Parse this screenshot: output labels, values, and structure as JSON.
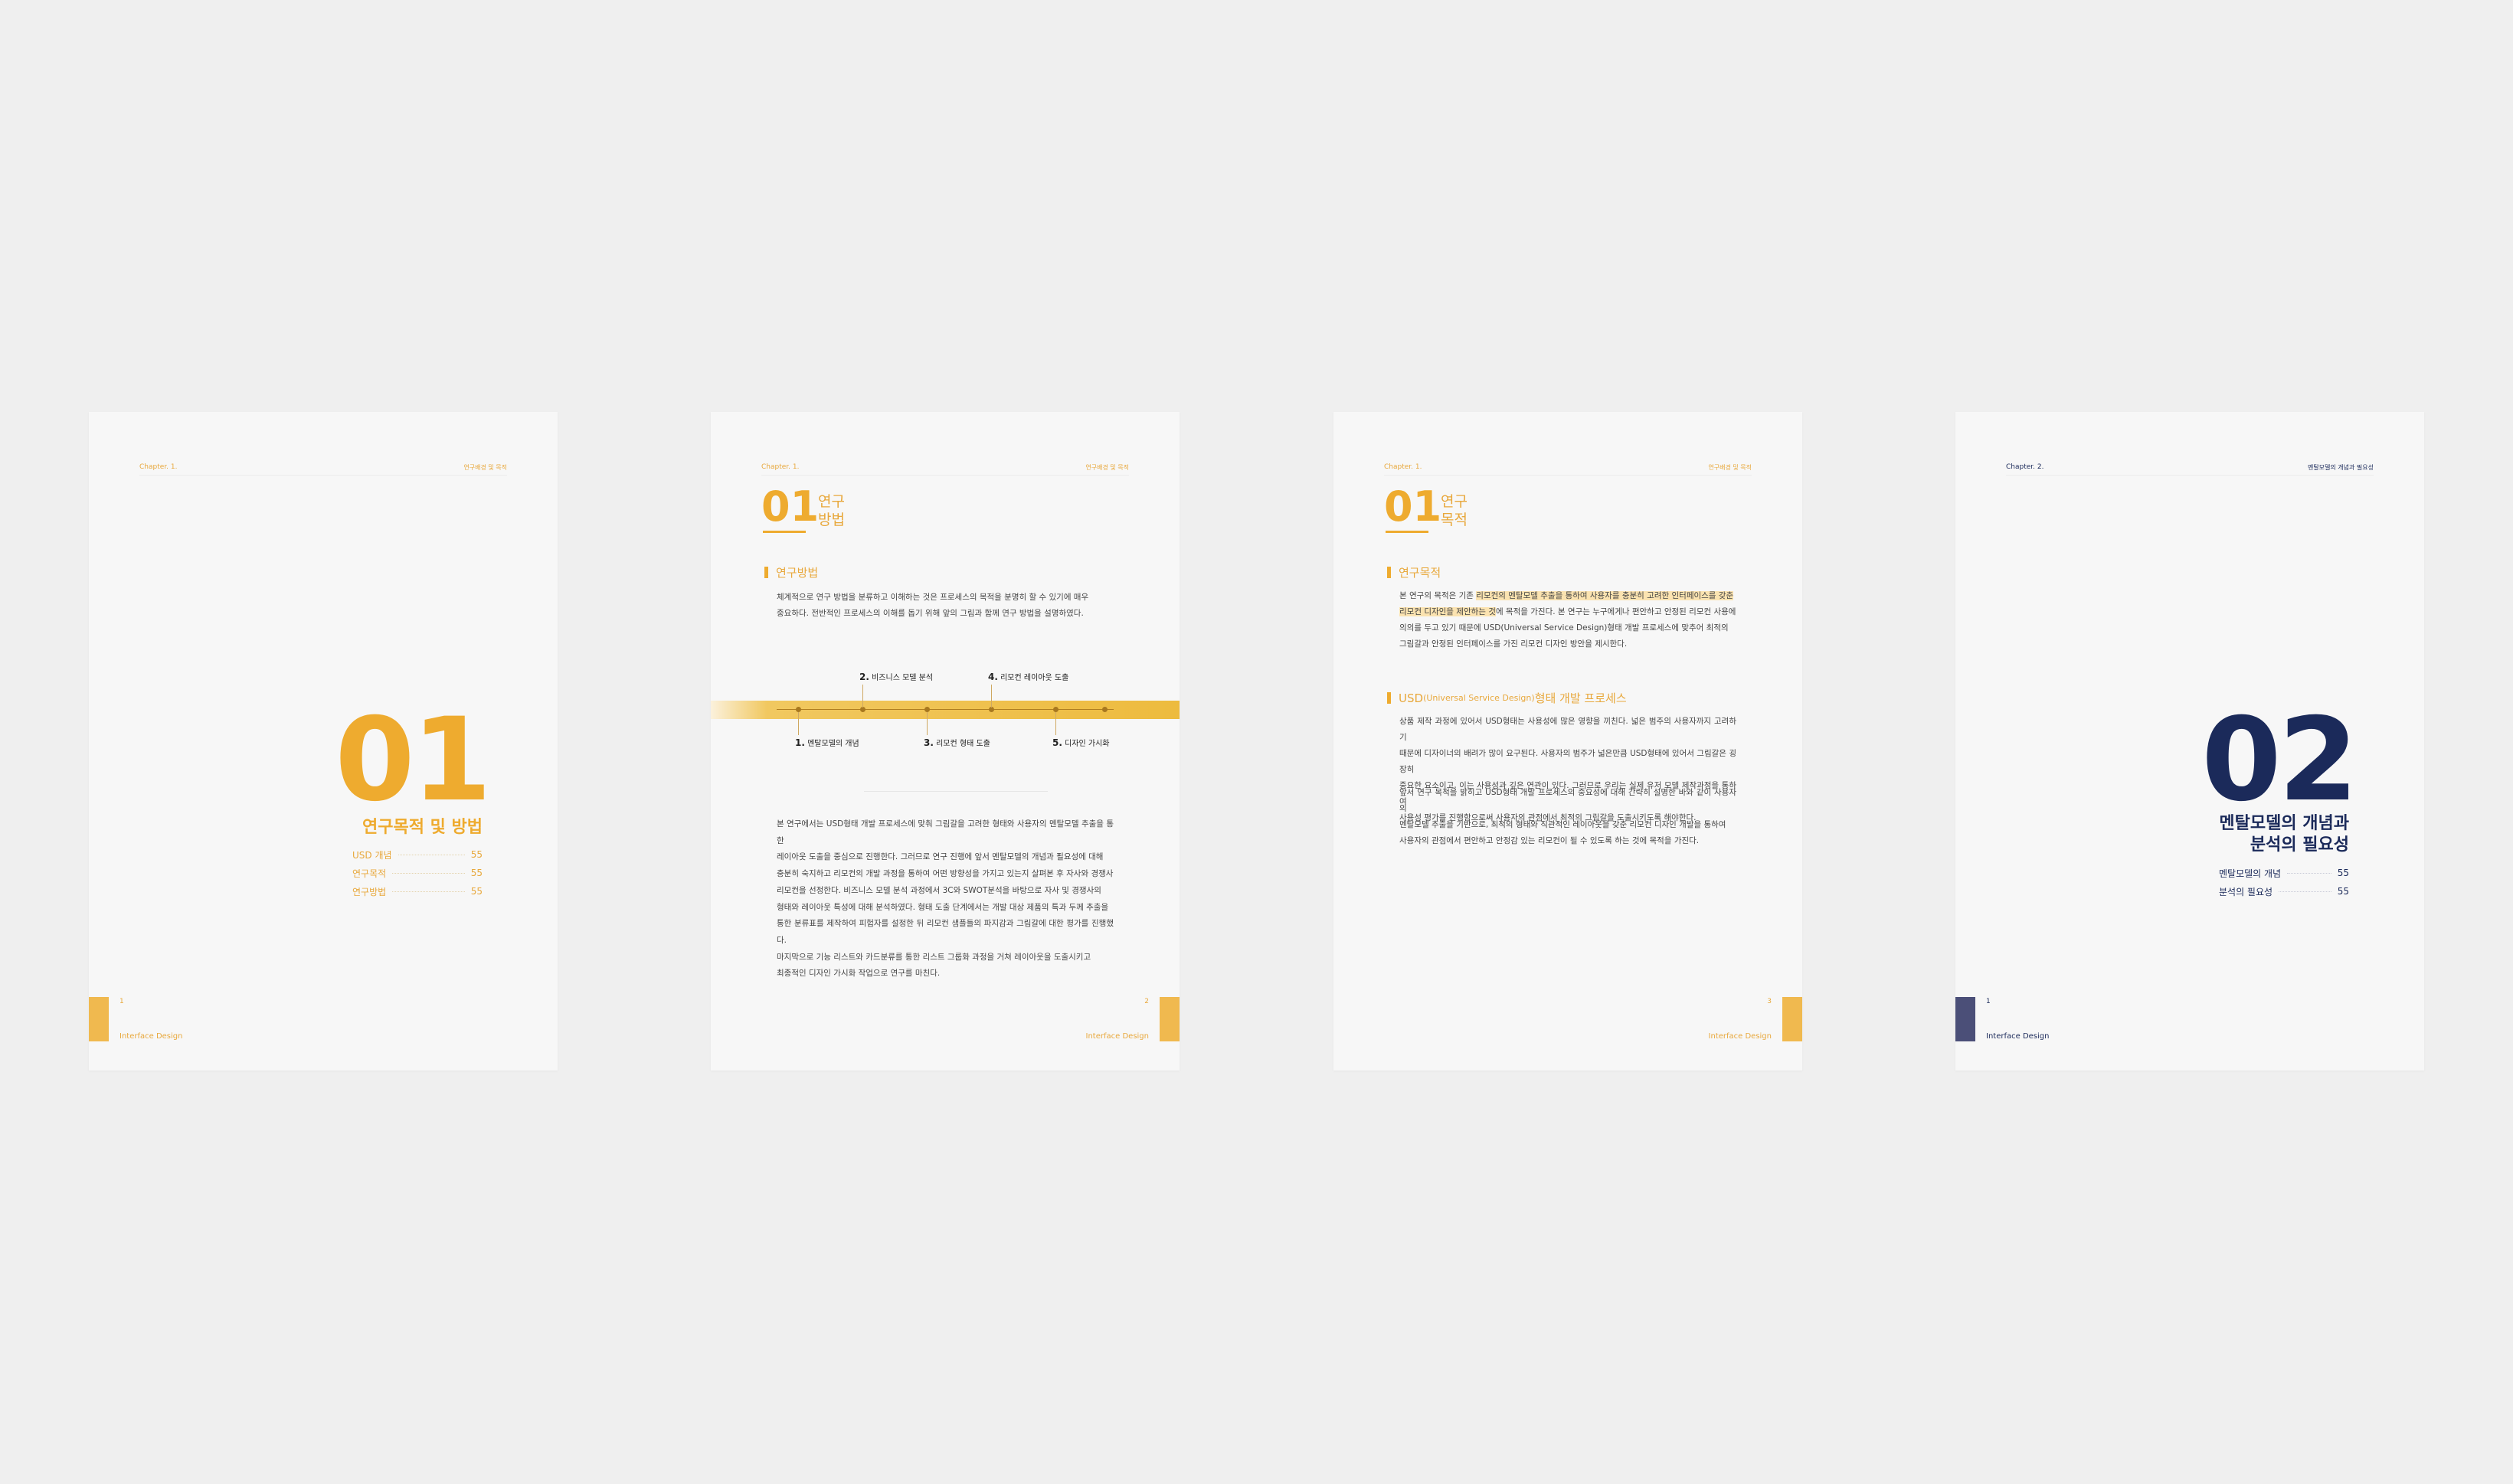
{
  "pages": [
    {
      "chapter": "Chapter. 1.",
      "header_right": "연구배경 및 목적",
      "big_number": "01",
      "title": "연구목적 및 방법",
      "toc": [
        {
          "label": "USD 개념",
          "page": "55"
        },
        {
          "label": "연구목적",
          "page": "55"
        },
        {
          "label": "연구방법",
          "page": "55"
        }
      ],
      "page_number": "1",
      "footer": "Interface Design"
    },
    {
      "chapter": "Chapter. 1.",
      "header_right": "연구배경 및 목적",
      "section_number": "01",
      "section_title": [
        "연구",
        "방법"
      ],
      "subheading": "연구방법",
      "intro_lines": [
        "체계적으로 연구 방법을 분류하고 이해하는 것은 프로세스의 목적을 분명히 할 수 있기에 매우",
        "중요하다. 전반적인 프로세스의 이해를 돕기 위해 앞의 그림과 함께 연구 방법을 설명하였다."
      ],
      "timeline": {
        "top": [
          {
            "num": "2.",
            "label": "비즈니스 모델 분석"
          },
          {
            "num": "4.",
            "label": "리모컨 레이아웃 도출"
          }
        ],
        "bottom": [
          {
            "num": "1.",
            "label": "멘탈모델의 개념"
          },
          {
            "num": "3.",
            "label": "리모컨 형태 도출"
          },
          {
            "num": "5.",
            "label": "디자인 가시화"
          }
        ]
      },
      "body_lines": [
        "본 연구에서는 USD형태 개발 프로세스에 맞춰 그림갈을 고려한 형태와 사용자의 멘탈모델 추출을 통한",
        "레이아웃 도출을 중심으로 진행한다. 그러므로 연구 진행에 앞서 멘탈모델의 개념과 필요성에 대해",
        "충분히 숙지하고 리모컨의 개발 과정을 통하여 어떤 방향성을 가지고 있는지 살펴본 후 자사와 경쟁사",
        "리모컨을 선정한다. 비즈니스 모델 분석 과정에서 3C와 SWOT분석을 바탕으로 자사 및 경쟁사의",
        "형태와 레이아웃 특성에 대해 분석하였다. 형태 도출 단계에서는 개발 대상 제품의 특과 두께 추출을",
        "통한 분류표를 제작하여 피험자를 설정한 뒤 리모컨 샘플들의 파지감과 그림갈에 대한 평가를 진행했다.",
        "마지막으로 기능 리스트와 카드분류를 통한 리스트 그룹화 과정을 거쳐 레이아웃을 도출시키고",
        "최종적인 디자인 가시화 작업으로 연구를 마친다."
      ],
      "page_number": "2",
      "footer": "Interface Design"
    },
    {
      "chapter": "Chapter. 1.",
      "header_right": "연구배경 및 목적",
      "section_number": "01",
      "section_title": [
        "연구",
        "목적"
      ],
      "subheading1": "연구목적",
      "para1": {
        "l1_pre": "본 연구의 목적은 기존 ",
        "l1_hl": "리모컨의 멘탈모델 추출을 통하여 사용자를 충분히 고려한 인터페이스를 갖춘",
        "l2_hl": "리모컨 디자인을 제안하는 것",
        "l2_post": "에 목적을 가진다. 본 연구는 누구에게나 편안하고 안정된 리모컨 사용에",
        "l3": "의의를 두고 있기 때문에 USD(Universal Service Design)형태 개발 프로세스에 맞추어 최적의",
        "l4": "그림갈과 안정된 인터페이스를 가진 리모컨 디자인 방안을 제시한다."
      },
      "subheading2_main": "USD",
      "subheading2_sub": "(Universal Service Design)",
      "subheading2_tail": "형태 개발 프로세스",
      "para2_lines": [
        "상품 제작 과정에 있어서 USD형태는 사용성에 많은 영향을 끼친다. 넓은 범주의 사용자까지 고려하기",
        "때문에 디자이너의 배려가 많이 요구된다. 사용자의 범주가 넓은만큼 USD형태에 있어서 그림갈은 굉장히",
        "중요한 요소이고, 이는 사용성과 깊은 연관이 있다. 그러므로 우리는 실제 유저 모델 제작과정을 통하여",
        "사용성 평가를 진행함으로써 사용자의 관점에서 최적의 그립갈을 도출시키도록 해야한다."
      ],
      "para3_lines": [
        "앞서 연구 목적을 밝히고 USD형태 개발 프로세스의 중요성에 대해 간략히 설명한 바와 같이 사용자의",
        "멘탈모델 추출을 기반으로, 최적의 형태와 직관적인 레이아웃을 갖춘 리모컨 디자인 개발을 통하여",
        "사용자의 관점에서 편안하고 안정감 있는 리모컨이 될 수 있도록 하는 것에 목적을 가진다."
      ],
      "page_number": "3",
      "footer": "Interface Design"
    },
    {
      "chapter": "Chapter. 2.",
      "header_right": "멘탈모델의 개념과 필요성",
      "big_number": "02",
      "title_lines": [
        "멘탈모델의 개념과",
        "분석의 필요성"
      ],
      "toc": [
        {
          "label": "멘탈모델의 개념",
          "page": "55"
        },
        {
          "label": "분석의 필요성",
          "page": "55"
        }
      ],
      "page_number": "1",
      "footer": "Interface Design"
    }
  ],
  "colors": {
    "background": "#efefef",
    "page": "#f7f7f7",
    "accent": "#eeab2f",
    "navy": "#1b2a5a",
    "navy_bar": "#4b4f78"
  }
}
